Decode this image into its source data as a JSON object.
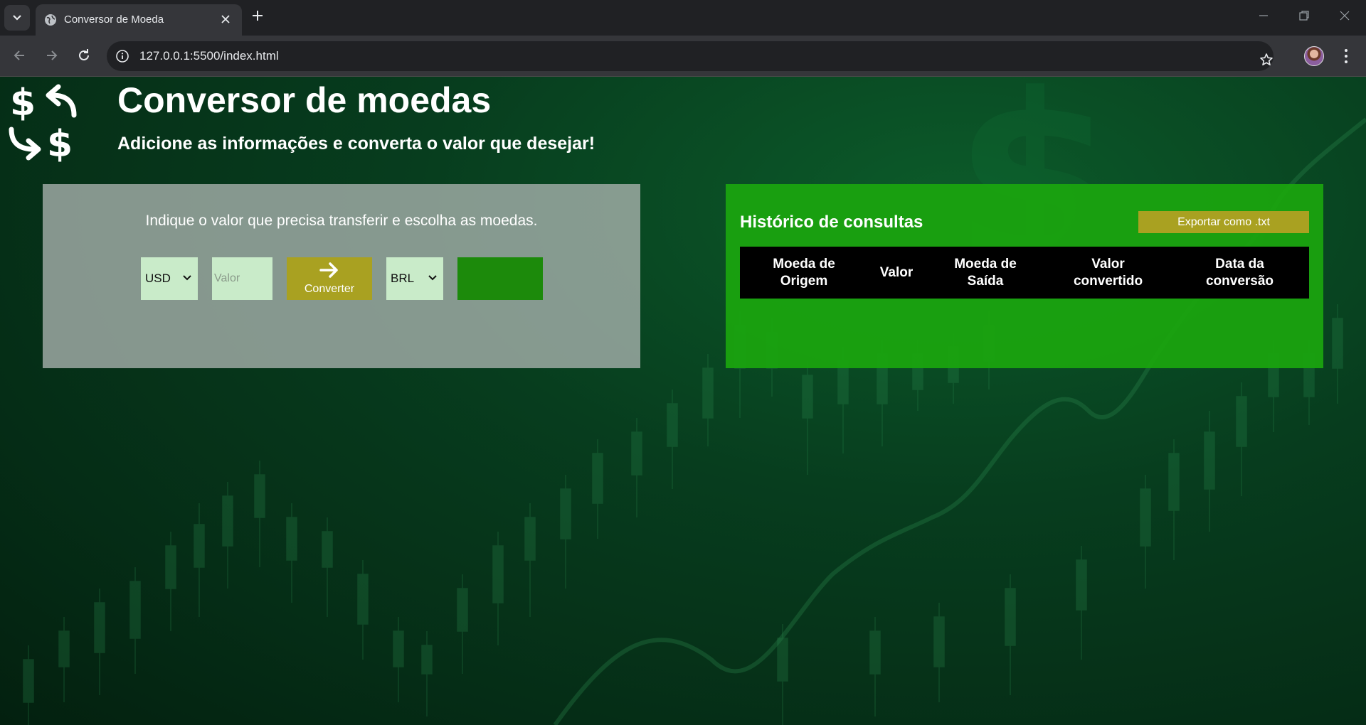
{
  "browser": {
    "tab_title": "Conversor de Moeda",
    "url": "127.0.0.1:5500/index.html"
  },
  "page": {
    "title": "Conversor de moedas",
    "subtitle": "Adicione as informações e converta o valor que desejar!"
  },
  "converter": {
    "instruction": "Indique o valor que precisa transferir e escolha as moedas.",
    "from_currency": "USD",
    "amount_placeholder": "Valor",
    "convert_label": "Converter",
    "to_currency": "BRL",
    "result": ""
  },
  "history": {
    "title": "Histórico de consultas",
    "export_label": "Exportar como .txt",
    "columns": {
      "origin": [
        "Moeda de",
        "Origem"
      ],
      "value": "Valor",
      "target": [
        "Moeda de",
        "Saída"
      ],
      "converted": [
        "Valor",
        "convertido"
      ],
      "date": [
        "Data da",
        "conversão"
      ]
    }
  },
  "colors": {
    "converter_panel": "#aab4af",
    "history_panel": "#1aa30f",
    "button_accent": "#a9a121",
    "input_bg": "#c9ebc9",
    "result_bg": "#1c8a0b"
  },
  "icons": [
    "tab-list-icon",
    "globe-icon",
    "close-icon",
    "plus-icon",
    "back-icon",
    "forward-icon",
    "reload-icon",
    "site-info-icon",
    "star-icon",
    "kebab-menu-icon",
    "currency-exchange-icon",
    "arrow-right-icon",
    "chevron-down-icon"
  ]
}
